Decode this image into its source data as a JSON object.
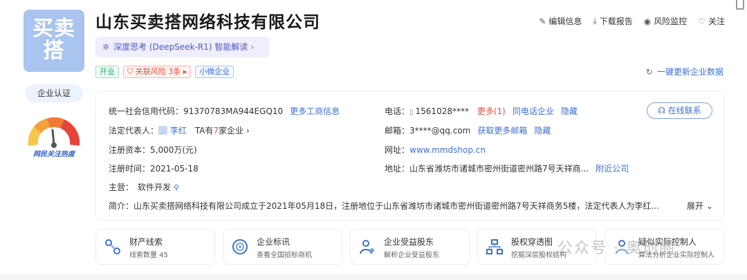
{
  "company": {
    "logo_text_line1": "买卖",
    "logo_text_line2": "搭",
    "name": "山东买卖搭网络科技有限公司",
    "certify_label": "企业认证",
    "heat_label": "网民关注热度"
  },
  "ai": {
    "label": "深度思考 (DeepSeek-R1) 智能解读",
    "chevron": "›"
  },
  "tags": [
    {
      "label": "开业"
    },
    {
      "label": "关联风险 3条"
    },
    {
      "label": "小微企业"
    }
  ],
  "actions": [
    {
      "icon": "✎",
      "label": "编辑信息"
    },
    {
      "icon": "⤓",
      "label": "下载报告"
    },
    {
      "icon": "◉",
      "label": "风险监控"
    },
    {
      "icon": "♡",
      "label": "关注"
    }
  ],
  "refresh": {
    "icon": "↻",
    "label": "一键更新企业数据"
  },
  "info": {
    "credit_code_label": "统一社会信用代码：",
    "credit_code": "91370783MA944EGQ10",
    "more_business": "更多工商信息",
    "legal_rep_label": "法定代表人：",
    "legal_rep": "李红",
    "legal_rep_extra_pre": "TA有",
    "legal_rep_count": "7",
    "legal_rep_extra_post": "家企业",
    "capital_label": "注册资本：",
    "capital": "5,000万(元)",
    "reg_date_label": "注册时间：",
    "reg_date": "2021-05-18",
    "business_label": "主营：",
    "business": "软件开发",
    "phone_label": "电话：",
    "phone": "1561028****",
    "phone_more_pre": "更多",
    "phone_more_count": "(1)",
    "same_phone": "同电话企业",
    "hide1": "隐藏",
    "email_label": "邮箱：",
    "email": "3****@qq.com",
    "more_email": "获取更多邮箱",
    "hide2": "隐藏",
    "website_label": "网址：",
    "website": "www.mmdshop.cn",
    "address_label": "地址：",
    "address": "山东省潍坊市诸城市密州街道密州路7号天祥商...",
    "nearby": "附近公司",
    "online_contact": "在线联系",
    "intro_label": "简介：",
    "intro": "山东买卖搭网络科技有限公司成立于2021年05月18日，注册地位于山东省潍坊市诸城市密州街道密州路7号天祥商务5楼，法定代表人为李红...",
    "expand": "展开"
  },
  "cards": [
    {
      "title": "财产线索",
      "sub": "线索数量 45"
    },
    {
      "title": "企业标讯",
      "sub": "查看全国招标商机"
    },
    {
      "title": "企业受益股东",
      "sub": "解析企业受益股东"
    },
    {
      "title": "股权穿透图",
      "sub": "挖掘深层股权结构"
    },
    {
      "title": "疑似实际控制人",
      "sub": "算法分析企业实际控制人"
    }
  ],
  "watermark": "公众号 · 奥创圈",
  "colors": {
    "accent": "#3c6fd6",
    "risk": "#e4513a",
    "open_green": "#2aa46a",
    "logo_bg": "#a9c4ee"
  }
}
